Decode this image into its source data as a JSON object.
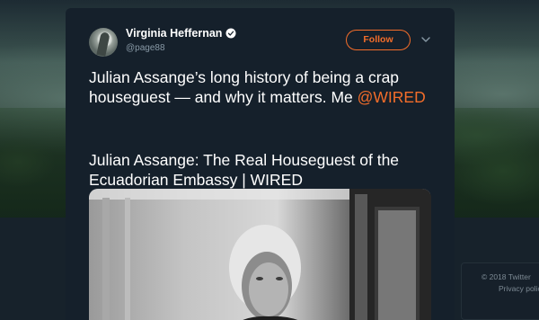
{
  "tweet": {
    "author_name": "Virginia Heffernan",
    "author_handle": "@page88",
    "follow_label": "Follow",
    "text_before_mention": "Julian Assange’s long history of being a crap houseguest — and why it matters. Me ",
    "mention": "@WIRED",
    "card_title": "Julian Assange: The Real Houseguest of the Ecuadorian Embassy | WIRED"
  },
  "footer": {
    "copyright": "© 2018 Twitter",
    "privacy": "Privacy polic"
  },
  "colors": {
    "accent": "#f36d2a",
    "tweet_bg": "#15202b",
    "handle": "#8899a6"
  },
  "icons": {
    "verified": "verified-badge-icon",
    "caret": "chevron-down-icon"
  }
}
